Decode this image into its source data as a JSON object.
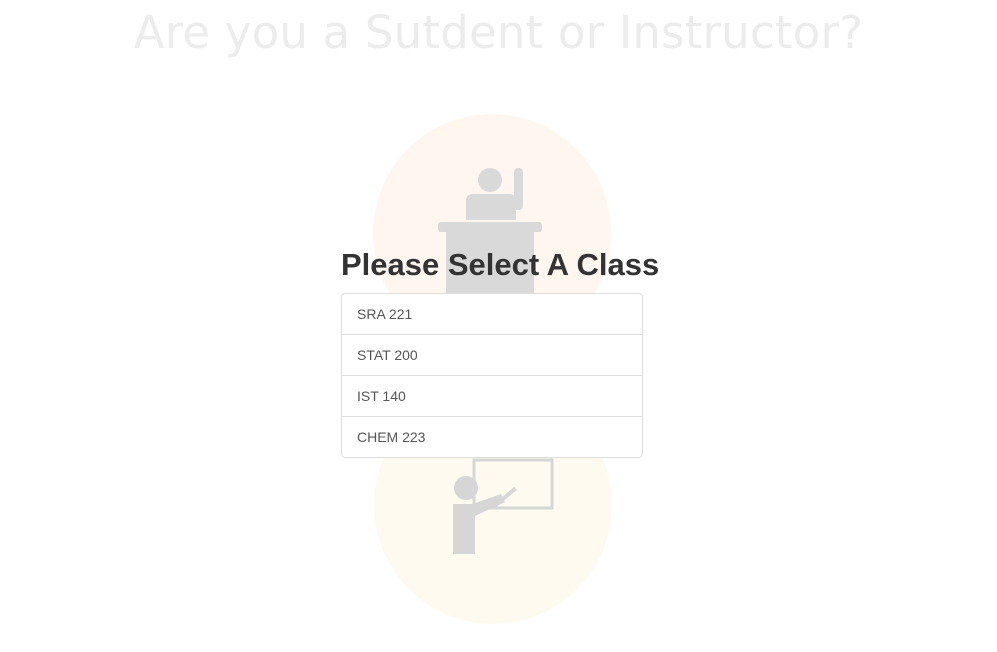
{
  "background": {
    "question": "Are you a Sutdent or Instructor?",
    "roles": [
      {
        "icon": "student-raising-hand-icon",
        "color": "#fff7ef"
      },
      {
        "icon": "teacher-at-board-icon",
        "color": "#fffaef"
      }
    ]
  },
  "modal": {
    "title": "Please Select A Class",
    "classes": [
      {
        "label": "SRA 221"
      },
      {
        "label": "STAT 200"
      },
      {
        "label": "IST 140"
      },
      {
        "label": "CHEM 223"
      }
    ]
  }
}
